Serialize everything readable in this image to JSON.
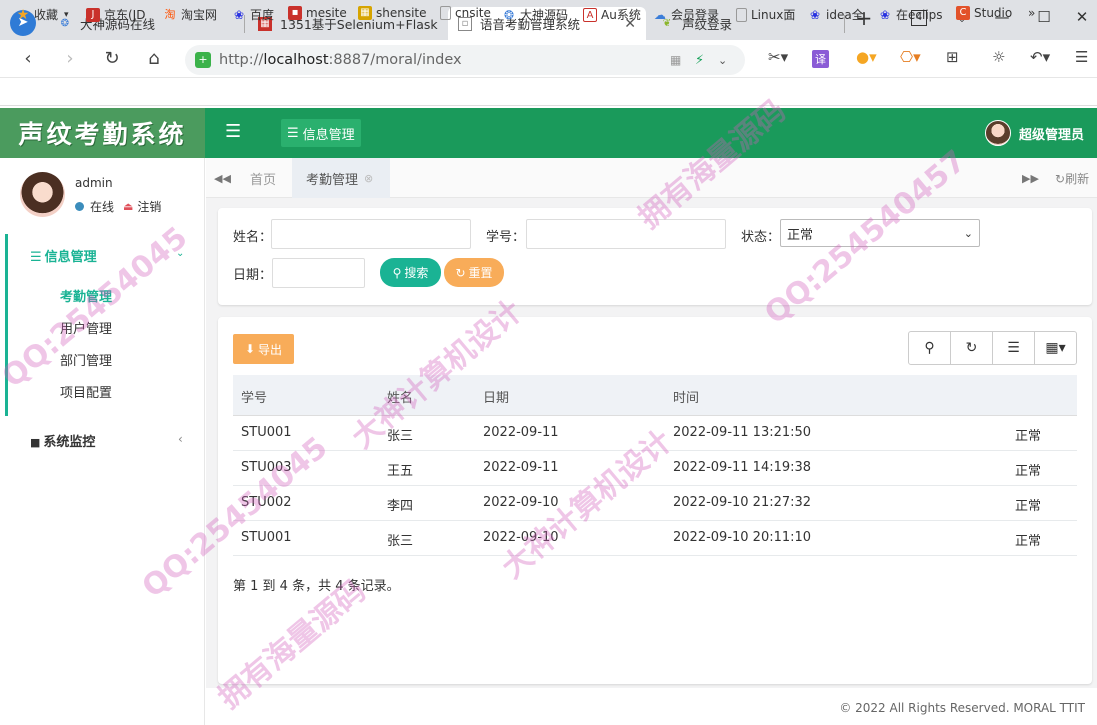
{
  "browser": {
    "tabs": [
      {
        "label": "大神源码在线"
      },
      {
        "label": "1351基于Selenium+Flask"
      },
      {
        "label": "语音考勤管理系统",
        "active": true
      },
      {
        "label": "声纹登录"
      }
    ],
    "tab_count": "4",
    "url_prefix": "http://",
    "url_host": "localhost",
    "url_rest": ":8887/moral/index",
    "bookmarks": [
      "收藏",
      "京东(JD",
      "淘宝网",
      "百度",
      "mesite",
      "shensite",
      "cnsite",
      "大神源码",
      "Au系统",
      "会员登录",
      "Linux面",
      "idea全",
      "在eclips",
      "Studio"
    ]
  },
  "app": {
    "logo": "声纹考勤系统",
    "top_menu": "信息管理",
    "top_user": "超级管理员"
  },
  "sidebar": {
    "username": "admin",
    "status": "在线",
    "logout": "注销",
    "group_label": "信息管理",
    "items": [
      {
        "label": "考勤管理",
        "active": true
      },
      {
        "label": "用户管理"
      },
      {
        "label": "部门管理"
      },
      {
        "label": "项目配置"
      }
    ],
    "monitor_label": "系统监控"
  },
  "tabs": {
    "home": "首页",
    "current": "考勤管理",
    "refresh": "刷新"
  },
  "search": {
    "name_label": "姓名：",
    "id_label": "学号：",
    "status_label": "状态：",
    "status_value": "正常",
    "date_label": "日期：",
    "search_button": "搜索",
    "reset_button": "重置"
  },
  "table": {
    "export_button": "导出",
    "headers": [
      "学号",
      "姓名",
      "日期",
      "时间"
    ],
    "rows": [
      {
        "id": "STU001",
        "name": "张三",
        "date": "2022-09-11",
        "time": "2022-09-11 13:21:50",
        "status": "正常"
      },
      {
        "id": "STU003",
        "name": "王五",
        "date": "2022-09-11",
        "time": "2022-09-11 14:19:38",
        "status": "正常"
      },
      {
        "id": "STU002",
        "name": "李四",
        "date": "2022-09-10",
        "time": "2022-09-10 21:27:32",
        "status": "正常"
      },
      {
        "id": "STU001",
        "name": "张三",
        "date": "2022-09-10",
        "time": "2022-09-10 20:11:10",
        "status": "正常"
      }
    ],
    "summary": "第 1 到 4 条，共 4 条记录。"
  },
  "footer": {
    "copyright": "© 2022 All Rights Reserved. MORAL TTIT"
  },
  "watermark": [
    "QQ:25454045",
    "大神计算机设计",
    "拥有海量源码",
    "QQ:254540457",
    "大神计算机设计",
    "QQ:25454045",
    "拥有海量源码"
  ],
  "colors": {
    "brand": "#1a9a5b",
    "accent": "#1ab394",
    "warning": "#f8ac59"
  }
}
